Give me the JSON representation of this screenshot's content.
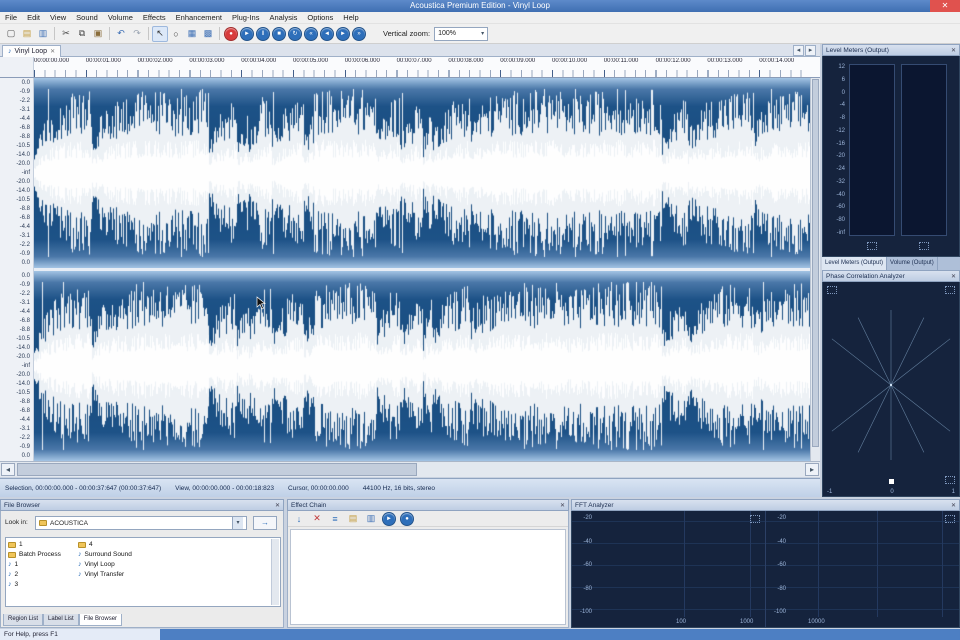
{
  "window": {
    "title": "Acoustica Premium Edition - Vinyl Loop",
    "close_label": "✕"
  },
  "menu": {
    "items": [
      "File",
      "Edit",
      "View",
      "Sound",
      "Volume",
      "Effects",
      "Enhancement",
      "Plug-Ins",
      "Analysis",
      "Options",
      "Help"
    ]
  },
  "toolbar": {
    "vertical_zoom_label": "Vertical zoom:",
    "vertical_zoom_value": "100%",
    "buttons": [
      {
        "name": "new-file-button",
        "glyph": "▢",
        "color": "#555555"
      },
      {
        "name": "open-file-button",
        "glyph": "▤",
        "color": "#c29a3a"
      },
      {
        "name": "save-file-button",
        "glyph": "▥",
        "color": "#3d6fb5"
      },
      {
        "type": "sep"
      },
      {
        "name": "cut-button",
        "glyph": "✂",
        "color": "#444444"
      },
      {
        "name": "copy-button",
        "glyph": "⧉",
        "color": "#444444"
      },
      {
        "name": "paste-button",
        "glyph": "▣",
        "color": "#8a6d3b"
      },
      {
        "type": "sep"
      },
      {
        "name": "undo-button",
        "glyph": "↶",
        "color": "#3d6fb5"
      },
      {
        "name": "redo-button",
        "glyph": "↷",
        "color": "#9aa4b2"
      },
      {
        "type": "sep"
      },
      {
        "name": "selection-tool-button",
        "glyph": "↖",
        "color": "#333333"
      },
      {
        "name": "zoom-tool-button",
        "glyph": "○",
        "color": "#333333"
      },
      {
        "name": "level-meters-toggle-button",
        "glyph": "▦",
        "color": "#3d6fb5"
      },
      {
        "name": "analyzers-toggle-button",
        "glyph": "▩",
        "color": "#3d6fb5"
      },
      {
        "type": "sep"
      },
      {
        "type": "round",
        "name": "record-button",
        "glyph": "●",
        "bg": "#d83c3c"
      },
      {
        "type": "round",
        "name": "play-button",
        "glyph": "►",
        "bg": "#2e6fba"
      },
      {
        "type": "round",
        "name": "pause-button",
        "glyph": "‖",
        "bg": "#2e6fba"
      },
      {
        "type": "round",
        "name": "stop-button",
        "glyph": "■",
        "bg": "#2e6fba"
      },
      {
        "type": "round",
        "name": "loop-button",
        "glyph": "↻",
        "bg": "#2e6fba"
      },
      {
        "type": "round",
        "name": "go-to-start-button",
        "glyph": "«",
        "bg": "#2e6fba"
      },
      {
        "type": "round",
        "name": "rewind-button",
        "glyph": "◄",
        "bg": "#2e6fba"
      },
      {
        "type": "round",
        "name": "forward-button",
        "glyph": "►",
        "bg": "#2e6fba"
      },
      {
        "type": "round",
        "name": "go-to-end-button",
        "glyph": "»",
        "bg": "#2e6fba"
      }
    ]
  },
  "document_tab": {
    "label": "Vinyl Loop",
    "close_label": "✕"
  },
  "tab_scroll": {
    "left": "◂",
    "right": "▸"
  },
  "timeline": {
    "labels": [
      "00:00:00.000",
      "00:00:01.000",
      "00:00:02.000",
      "00:00:03.000",
      "00:00:04.000",
      "00:00:05.000",
      "00:00:06.000",
      "00:00:07.000",
      "00:00:08.000",
      "00:00:09.000",
      "00:00:10.000",
      "00:00:11.000",
      "00:00:12.000",
      "00:00:13.000",
      "00:00:14.000"
    ]
  },
  "waveform": {
    "db_labels": [
      "0.0",
      "-0.9",
      "-2.2",
      "-3.1",
      "-4.4",
      "-6.8",
      "-8.8",
      "-10.5",
      "-14.0",
      "-20.0",
      "-inf",
      "-20.0",
      "-14.0",
      "-10.5",
      "-8.8",
      "-6.8",
      "-4.4",
      "-3.1",
      "-2.2",
      "-0.9",
      "0.0"
    ]
  },
  "selection_bar": {
    "segments": [
      "Selection, 00:00:00.000 - 00:00:37:647 (00:00:37:647)",
      "View, 00:00:00.000 - 00:00:18:823",
      "Cursor, 00:00:00.000",
      "44100 Hz, 16 bits, stereo"
    ]
  },
  "level_meters": {
    "title": "Level Meters (Output)",
    "scale": [
      "12",
      "6",
      "0",
      "-4",
      "-8",
      "-12",
      "-16",
      "-20",
      "-24",
      "-32",
      "-40",
      "-60",
      "-80",
      "-inf"
    ],
    "tabs": [
      "Level Meters (Output)",
      "Volume (Output)"
    ]
  },
  "phase": {
    "title": "Phase Correlation Analyzer",
    "axis": [
      "-1",
      "0",
      "1"
    ]
  },
  "file_browser": {
    "title": "File Browser",
    "look_in_label": "Look in:",
    "look_in_value": "ACOUSTICA",
    "columns": [
      [
        {
          "label": "1",
          "type": "folder"
        },
        {
          "label": "Batch Process",
          "type": "folder"
        },
        {
          "label": "1",
          "type": "audio"
        },
        {
          "label": "2",
          "type": "audio"
        },
        {
          "label": "3",
          "type": "audio"
        }
      ],
      [
        {
          "label": "4",
          "type": "folder"
        },
        {
          "label": "Surround Sound",
          "type": "audio"
        },
        {
          "label": "Vinyl Loop",
          "type": "audio"
        },
        {
          "label": "Vinyl Transfer",
          "type": "audio"
        }
      ]
    ],
    "tabs": [
      "Region List",
      "Label List",
      "File Browser"
    ]
  },
  "effect_chain": {
    "title": "Effect Chain",
    "buttons": [
      {
        "name": "add-effect-button",
        "glyph": "↓",
        "color": "#2e6fba"
      },
      {
        "name": "remove-effect-button",
        "glyph": "✕",
        "color": "#c23b3b"
      },
      {
        "name": "edit-effect-button",
        "glyph": "≡",
        "color": "#2e6fba"
      },
      {
        "name": "open-chain-button",
        "glyph": "▤",
        "color": "#c29a3a"
      },
      {
        "name": "save-chain-button",
        "glyph": "▥",
        "color": "#3d6fb5"
      },
      {
        "type": "round",
        "name": "preview-play-button",
        "glyph": "►",
        "bg": "#2e6fba"
      },
      {
        "type": "round",
        "name": "preview-record-button",
        "glyph": "●",
        "bg": "#2e6fba"
      }
    ]
  },
  "fft": {
    "title": "FFT Analyzer",
    "y_labels": [
      "-20",
      "-40",
      "-60",
      "-80",
      "-100"
    ],
    "x_labels": [
      "100",
      "1000",
      "10000"
    ]
  },
  "status_bar": {
    "help_text": "For Help, press F1"
  }
}
